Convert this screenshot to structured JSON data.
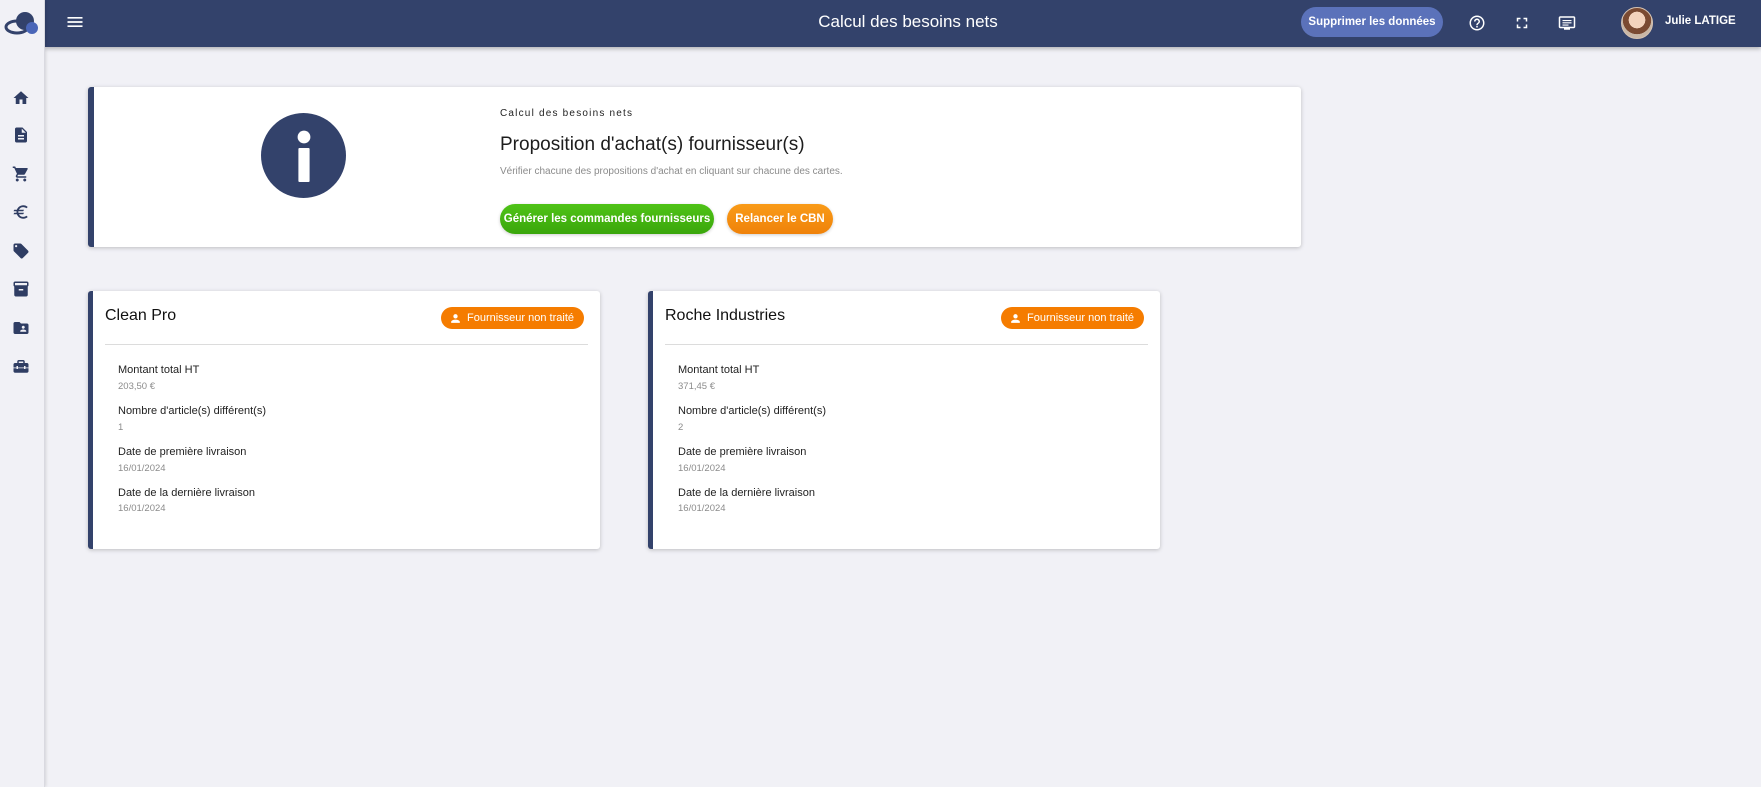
{
  "header": {
    "title": "Calcul des besoins nets",
    "delete_label": "Supprimer les données",
    "user_name": "Julie LATIGE"
  },
  "sidebar": {
    "items": [
      "home-icon",
      "document-icon",
      "cart-icon",
      "euro-icon",
      "tag-icon",
      "archive-icon",
      "contact-folder-icon",
      "toolbox-icon"
    ]
  },
  "info": {
    "kicker": "Calcul des besoins nets",
    "title": "Proposition d'achat(s) fournisseur(s)",
    "description": "Vérifier chacune des propositions d'achat en cliquant sur chacune des cartes.",
    "generate_label": "Générer les commandes fournisseurs",
    "rerun_label": "Relancer le CBN"
  },
  "suppliers": [
    {
      "name": "Clean Pro",
      "status": "Fournisseur non traité",
      "fields": [
        {
          "label": "Montant total HT",
          "value": "203,50 €"
        },
        {
          "label": "Nombre d'article(s) différent(s)",
          "value": "1"
        },
        {
          "label": "Date de première livraison",
          "value": "16/01/2024"
        },
        {
          "label": "Date de la dernière livraison",
          "value": "16/01/2024"
        }
      ]
    },
    {
      "name": "Roche Industries",
      "status": "Fournisseur non traité",
      "fields": [
        {
          "label": "Montant total HT",
          "value": "371,45 €"
        },
        {
          "label": "Nombre d'article(s) différent(s)",
          "value": "2"
        },
        {
          "label": "Date de première livraison",
          "value": "16/01/2024"
        },
        {
          "label": "Date de la dernière livraison",
          "value": "16/01/2024"
        }
      ]
    }
  ],
  "colors": {
    "primary": "#33426b",
    "accent_blue": "#5b72ba",
    "green": "#3aa60b",
    "orange": "#f57c00",
    "background": "#f1f1f6"
  }
}
